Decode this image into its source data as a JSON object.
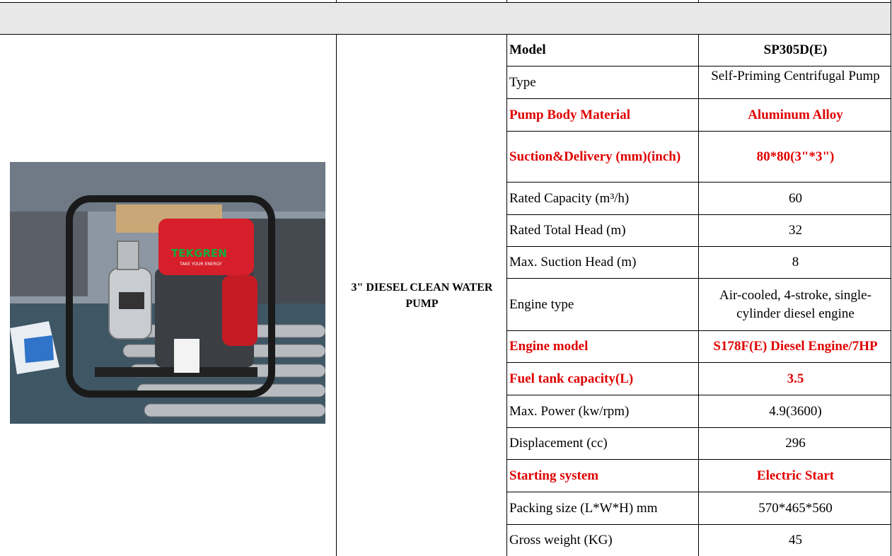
{
  "product": {
    "name": "3\" DIESEL CLEAN WATER PUMP"
  },
  "photo": {
    "brand": "TEKGREN",
    "tagline": "TAKE YOUR ENERGY"
  },
  "specs": [
    {
      "label": "Model",
      "value": "SP305D(E)"
    },
    {
      "label": "Type",
      "value": "Self-Priming Centrifugal Pump"
    },
    {
      "label": "Pump Body Material",
      "value": "Aluminum Alloy"
    },
    {
      "label": "Suction&Delivery (mm)(inch)",
      "value": "80*80(3\"*3\")"
    },
    {
      "label": "Rated Capacity (m³/h)",
      "value": "60"
    },
    {
      "label": "Rated Total Head (m)",
      "value": "32"
    },
    {
      "label": "Max. Suction Head (m)",
      "value": "8"
    },
    {
      "label": "Engine type",
      "value": "Air-cooled, 4-stroke, single-cylinder diesel engine"
    },
    {
      "label": "Engine model",
      "value": "S178F(E) Diesel Engine/7HP"
    },
    {
      "label": "Fuel tank capacity(L)",
      "value": "3.5"
    },
    {
      "label": "Max. Power (kw/rpm)",
      "value": "4.9(3600)"
    },
    {
      "label": "Displacement (cc)",
      "value": "296"
    },
    {
      "label": "Starting system",
      "value": "Electric Start"
    },
    {
      "label": "Packing size (L*W*H) mm",
      "value": "570*465*560"
    },
    {
      "label": "Gross weight (KG)",
      "value": "45"
    }
  ],
  "colors": {
    "highlight": "#e00000",
    "band": "#e8e8e8"
  }
}
